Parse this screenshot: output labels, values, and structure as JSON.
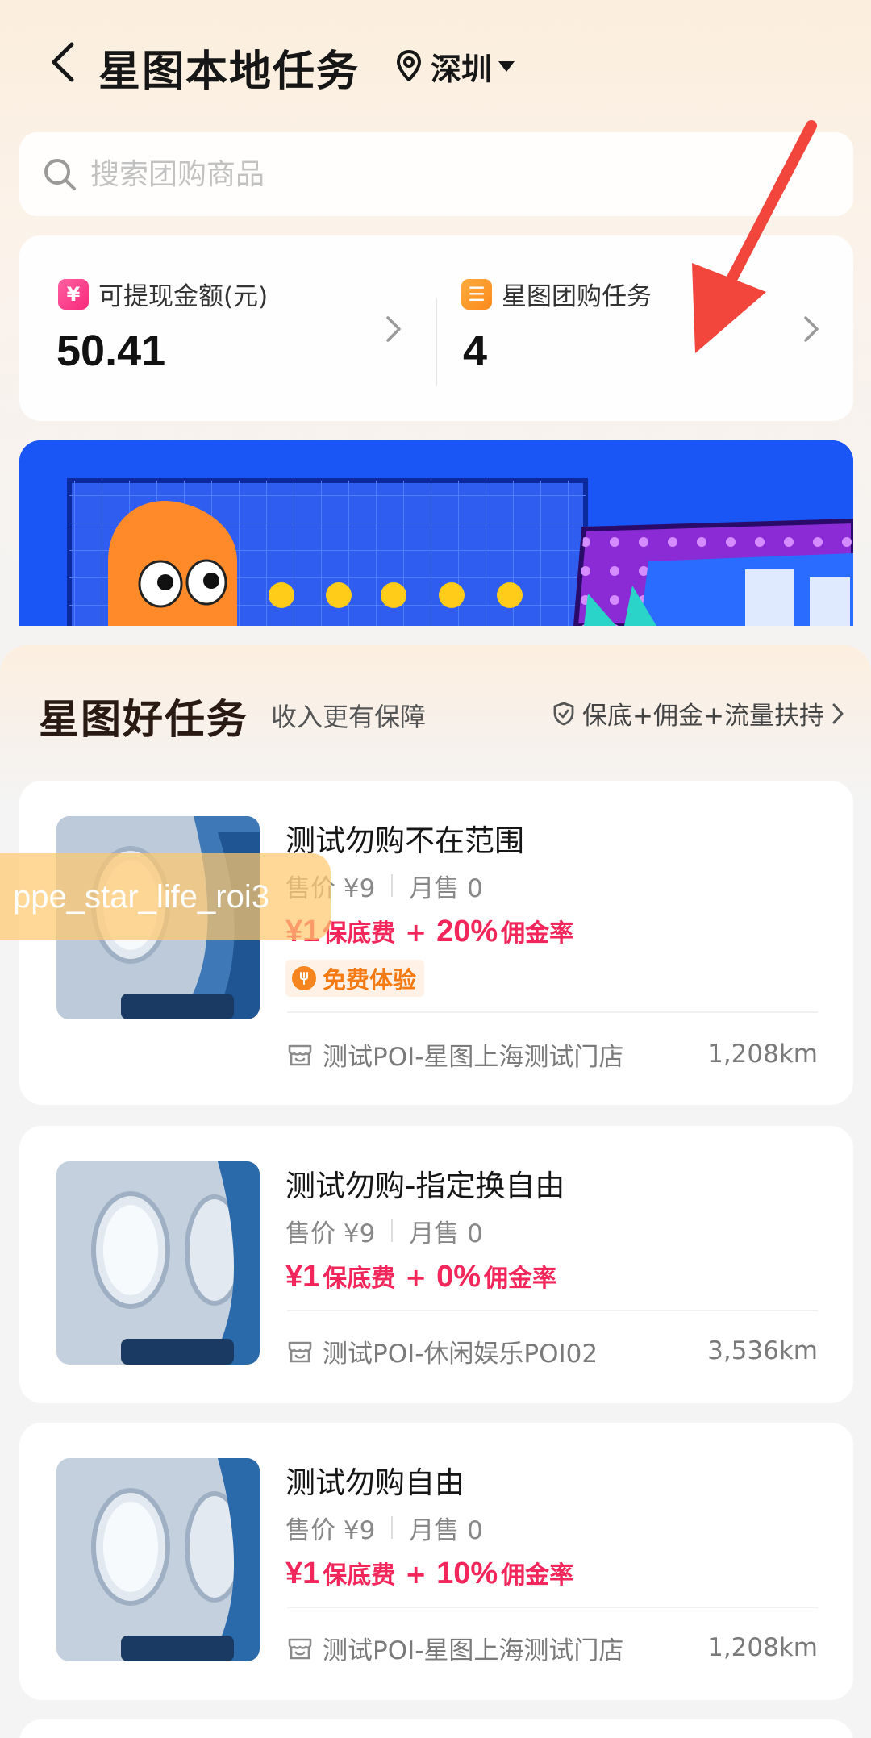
{
  "header": {
    "title": "星图本地任务",
    "city": "深圳"
  },
  "search": {
    "placeholder": "搜索团购商品"
  },
  "stats": {
    "withdraw_label": "可提现金额(元)",
    "withdraw_value": "50.41",
    "withdraw_badge": "¥",
    "task_label": "星图团购任务",
    "task_value": "4",
    "task_badge": "☰"
  },
  "section": {
    "title": "星图好任务",
    "subtitle": "收入更有保障",
    "guarantee": "保底+佣金+流量扶持"
  },
  "overlay": {
    "label": "ppe_star_life_roi3"
  },
  "tasks": [
    {
      "title": "测试勿购不在范围",
      "price": "售价 ¥9",
      "sales": "月售 0",
      "guarantee_amount": "¥1",
      "guarantee_label": "保底费",
      "plus": "+",
      "commission_rate": "20%",
      "commission_label": "佣金率",
      "tag": "免费体验",
      "shop": "测试POI-星图上海测试门店",
      "distance": "1,208km"
    },
    {
      "title": "测试勿购-指定换自由",
      "price": "售价 ¥9",
      "sales": "月售 0",
      "guarantee_amount": "¥1",
      "guarantee_label": "保底费",
      "plus": "+",
      "commission_rate": "0%",
      "commission_label": "佣金率",
      "shop": "测试POI-休闲娱乐POI02",
      "distance": "3,536km"
    },
    {
      "title": "测试勿购自由",
      "price": "售价 ¥9",
      "sales": "月售 0",
      "guarantee_amount": "¥1",
      "guarantee_label": "保底费",
      "plus": "+",
      "commission_rate": "10%",
      "commission_label": "佣金率",
      "shop": "测试POI-星图上海测试门店",
      "distance": "1,208km"
    }
  ],
  "colors": {
    "accent": "#f2265a",
    "tag": "#f47b14",
    "annotation_arrow": "#f2453c",
    "banner_bg": "#1a55f5"
  }
}
